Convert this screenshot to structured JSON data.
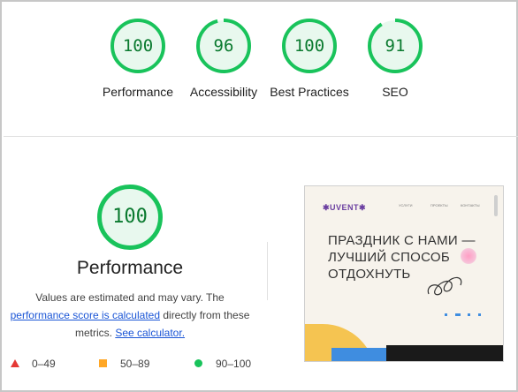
{
  "summary_scores": [
    {
      "value": "100",
      "label": "Performance",
      "fraction": 1.0,
      "color": "#19c35b"
    },
    {
      "value": "96",
      "label": "Accessibility",
      "fraction": 0.96,
      "color": "#19c35b"
    },
    {
      "value": "100",
      "label": "Best Practices",
      "fraction": 1.0,
      "color": "#19c35b"
    },
    {
      "value": "91",
      "label": "SEO",
      "fraction": 0.91,
      "color": "#19c35b"
    }
  ],
  "performance": {
    "score": "100",
    "fraction": 1.0,
    "title": "Performance",
    "desc_part1": "Values are estimated and may vary. The ",
    "desc_link1": "performance score is calculated",
    "desc_part2": " directly from these metrics. ",
    "desc_link2": "See calculator."
  },
  "legend": [
    {
      "range": "0–49",
      "icon": "triangle-red-icon",
      "color": "#e53935"
    },
    {
      "range": "50–89",
      "icon": "square-orange-icon",
      "color": "#ffa726"
    },
    {
      "range": "90–100",
      "icon": "circle-green-icon",
      "color": "#19c35b"
    }
  ],
  "thumbnail": {
    "logo": "✱UVENT✱",
    "nav": [
      "УСЛУГИ",
      "ПРОЕКТЫ",
      "КОНТАКТЫ"
    ],
    "hero_line1": "ПРАЗДНИК С НАМИ —",
    "hero_line2": "ЛУЧШИЙ СПОСОБ",
    "hero_line3": "ОТДОХНУТЬ"
  },
  "colors": {
    "pass_green": "#19c35b",
    "pass_fill": "#e8f8ee",
    "score_text": "#0a7a2f",
    "link": "#1a55d6"
  }
}
